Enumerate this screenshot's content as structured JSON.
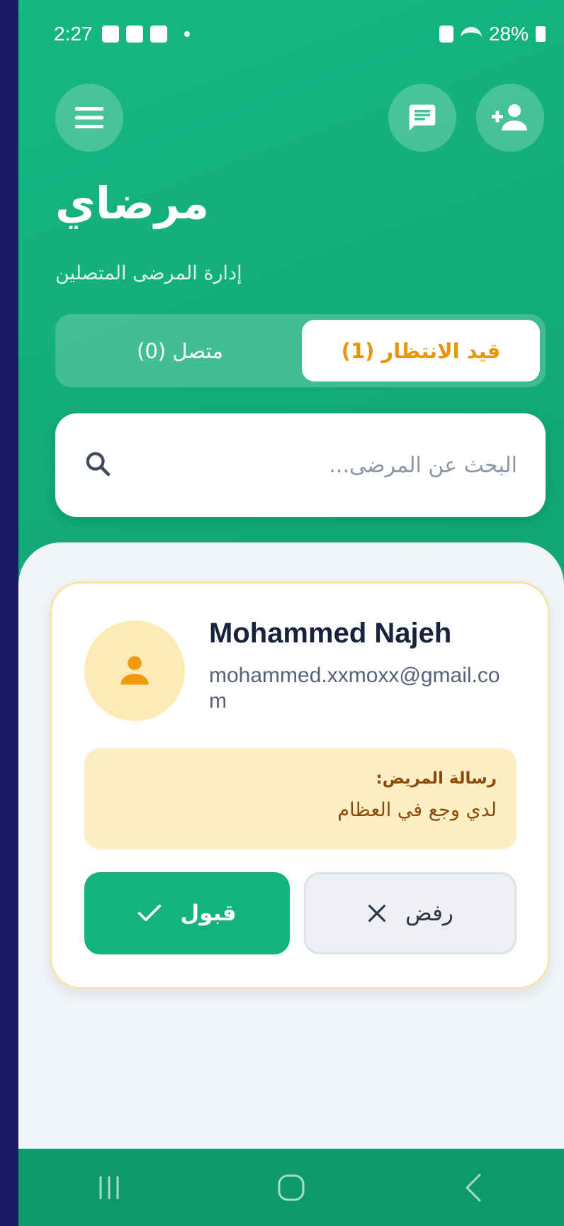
{
  "status_bar": {
    "time": "2:27",
    "battery": "28%"
  },
  "header": {
    "title": "مرضاي",
    "subtitle": "إدارة المرضى المتصلين"
  },
  "tabs": {
    "pending": "قيد الانتظار (1)",
    "connected": "متصل (0)"
  },
  "search": {
    "placeholder": "البحث عن المرضى..."
  },
  "patient": {
    "name": "Mohammed Najeh",
    "email": "mohammed.xxmoxx@gmail.com",
    "message_label": "رسالة المريض:",
    "message_text": "لدي وجع في العظام",
    "reject_label": "رفض",
    "accept_label": "قبول"
  },
  "colors": {
    "brand": "#13b27e",
    "pending_accent": "#e6960b",
    "message_bg": "#fdefc3"
  },
  "icons": [
    "menu-icon",
    "chat-icon",
    "add-person-icon",
    "search-icon",
    "person-icon",
    "close-icon",
    "check-icon",
    "recents-icon",
    "home-icon",
    "back-icon"
  ]
}
